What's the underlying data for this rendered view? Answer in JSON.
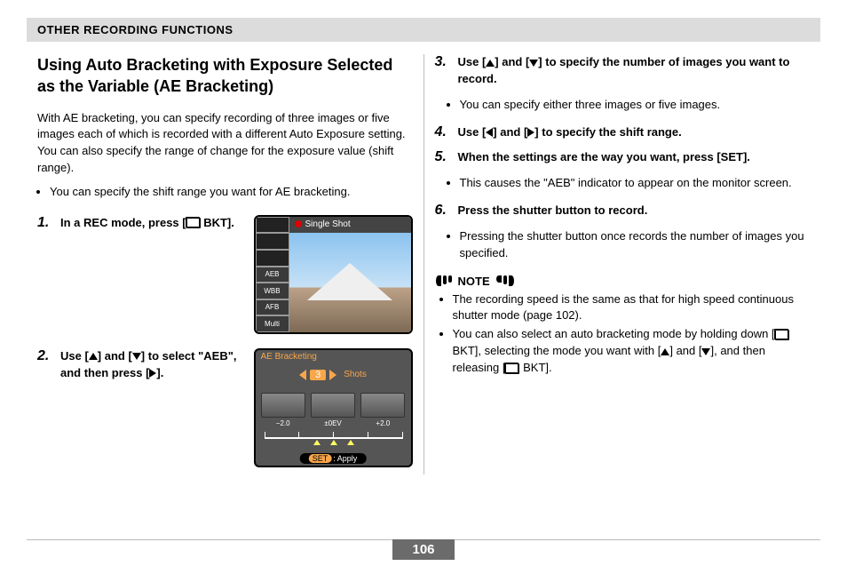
{
  "section_header": "OTHER RECORDING FUNCTIONS",
  "title": "Using Auto Bracketing with Exposure Selected as the Variable (AE Bracketing)",
  "intro": "With AE bracketing, you can specify recording of three images or five images each of which is recorded with a different Auto Exposure setting. You can also specify the range of change for the exposure value (shift range).",
  "intro_bullet": "You can specify the shift range you want for AE bracketing.",
  "steps": {
    "s1_num": "1.",
    "s1_a": "In a REC mode, press [",
    "s1_b": " BKT].",
    "s2_num": "2.",
    "s2_a": "Use [",
    "s2_b": "] and [",
    "s2_c": "] to select \"AEB\", and then press [",
    "s2_d": "].",
    "s3_num": "3.",
    "s3_a": "Use [",
    "s3_b": "] and [",
    "s3_c": "] to specify the number of images you want to record.",
    "s3_bullet": "You can specify either three images or five images.",
    "s4_num": "4.",
    "s4_a": "Use [",
    "s4_b": "] and [",
    "s4_c": "] to specify the shift range.",
    "s5_num": "5.",
    "s5_text": "When the settings are the way you want, press [SET].",
    "s5_bullet": "This causes the \"AEB\" indicator to appear on the monitor screen.",
    "s6_num": "6.",
    "s6_text": "Press the shutter button to record.",
    "s6_bullet": "Pressing the shutter button once records the number of images you specified."
  },
  "note": {
    "label": "NOTE",
    "b1": "The recording speed is the same as that for high speed continuous shutter mode (page 102).",
    "b2a": "You can also select an auto bracketing mode by holding down [",
    "b2b": " BKT], selecting the mode you want with [",
    "b2c": "] and [",
    "b2d": "], and then releasing [",
    "b2e": " BKT]."
  },
  "figure1": {
    "top_label": "Single Shot",
    "cells": [
      "",
      "",
      "",
      "AEB",
      "WBB",
      "AFB",
      "Multi"
    ]
  },
  "figure2": {
    "title": "AE Bracketing",
    "shots_num": "3",
    "shots_label": "Shots",
    "thumbs": [
      "−2.0",
      "±0EV",
      "+2.0"
    ],
    "apply_set": "SET",
    "apply_text": ": Apply"
  },
  "page_number": "106"
}
